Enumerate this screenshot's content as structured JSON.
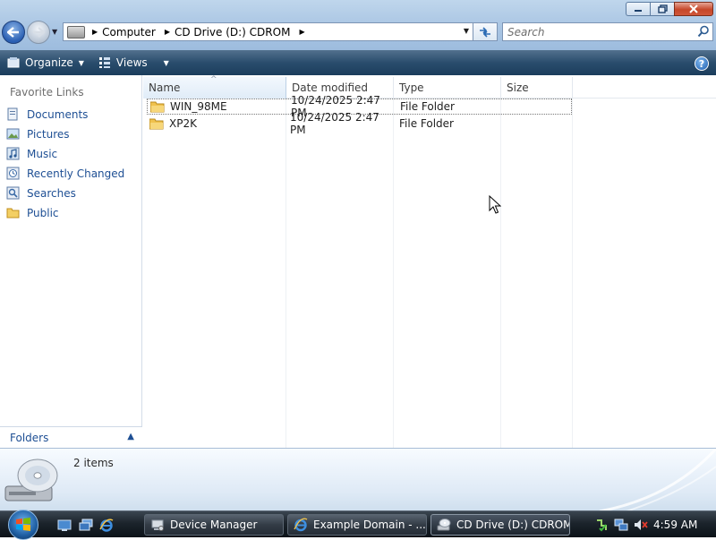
{
  "window": {
    "controls": {
      "minimize": "minimize-icon",
      "maximize": "maximize-icon",
      "close": "close-icon"
    }
  },
  "navigation": {
    "back_icon": "back-arrow-icon",
    "forward_icon": "forward-arrow-icon",
    "breadcrumbs": [
      "Computer",
      "CD Drive (D:) CDROM"
    ],
    "search_placeholder": "Search"
  },
  "toolbar": {
    "organize_label": "Organize",
    "views_label": "Views"
  },
  "sidebar": {
    "header": "Favorite Links",
    "items": [
      {
        "label": "Documents",
        "icon": "documents-icon"
      },
      {
        "label": "Pictures",
        "icon": "pictures-icon"
      },
      {
        "label": "Music",
        "icon": "music-icon"
      },
      {
        "label": "Recently Changed",
        "icon": "recently-changed-icon"
      },
      {
        "label": "Searches",
        "icon": "searches-icon"
      },
      {
        "label": "Public",
        "icon": "public-folder-icon"
      }
    ],
    "folders_label": "Folders"
  },
  "file_list": {
    "columns": [
      "Name",
      "Date modified",
      "Type",
      "Size"
    ],
    "rows": [
      {
        "name": "WIN_98ME",
        "date": "10/24/2025 2:47 PM",
        "type": "File Folder",
        "size": ""
      },
      {
        "name": "XP2K",
        "date": "10/24/2025 2:47 PM",
        "type": "File Folder",
        "size": ""
      }
    ]
  },
  "details_pane": {
    "item_count": "2 items"
  },
  "taskbar": {
    "buttons": [
      {
        "label": "Device Manager",
        "icon": "device-manager-icon"
      },
      {
        "label": "Example Domain - ...",
        "icon": "internet-explorer-icon"
      },
      {
        "label": "CD Drive (D:) CDROM",
        "icon": "cd-drive-icon",
        "active": true
      }
    ],
    "clock": "4:59 AM"
  },
  "colors": {
    "link": "#1e4f94",
    "command_bar": "#2a4d6d",
    "taskbar": "#1c242c"
  }
}
